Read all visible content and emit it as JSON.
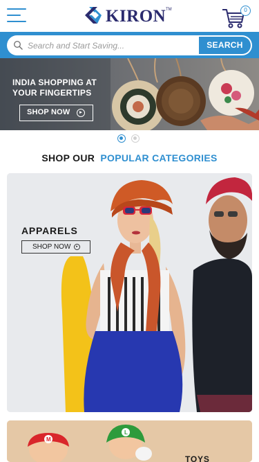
{
  "header": {
    "brand": "KIRON",
    "trademark": "TM",
    "cart_count": "0",
    "menu_icon": "hamburger-menu-icon",
    "cart_icon": "shopping-cart-icon"
  },
  "search": {
    "placeholder": "Search and Start Saving...",
    "button_label": "SEARCH",
    "icon": "search-icon"
  },
  "hero": {
    "title": "INDIA SHOPPING AT YOUR FINGERTIPS",
    "cta_label": "SHOP NOW",
    "cta_icon": "circle-arrow-right-icon",
    "slides_total": 2,
    "active_slide": 1
  },
  "categories_section": {
    "heading_prefix": "SHOP OUR",
    "heading_highlight": "POPULAR CATEGORIES"
  },
  "categories": [
    {
      "label": "APPARELS",
      "cta_label": "SHOP NOW"
    },
    {
      "label": "TOYS"
    }
  ],
  "colors": {
    "primary_blue": "#2f8fd0",
    "brand_navy": "#2b2b6e"
  }
}
